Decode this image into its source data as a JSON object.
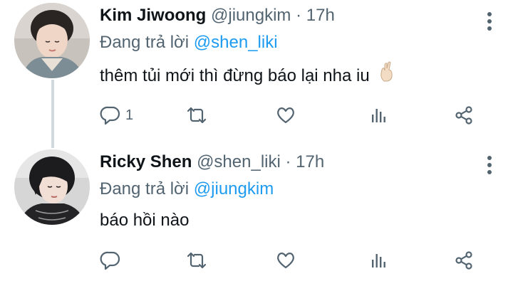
{
  "tweets": [
    {
      "name": "Kim Jiwoong",
      "handle": "@jiungkim",
      "separator": "·",
      "time": "17h",
      "reply_prefix": "Đang trả lời",
      "reply_to": "@shen_liki",
      "text": "thêm tủi mới thì đừng báo lại nha iu",
      "emoji_icon": "crossed-fingers-emoji",
      "reply_count": "1",
      "has_thread_line": true
    },
    {
      "name": "Ricky Shen",
      "handle": "@shen_liki",
      "separator": "·",
      "time": "17h",
      "reply_prefix": "Đang trả lời",
      "reply_to": "@jiungkim",
      "text": "báo hồi nào",
      "reply_count": "",
      "has_thread_line": false
    }
  ],
  "icons": {
    "actions": [
      "reply-icon",
      "retweet-icon",
      "like-icon",
      "stats-icon",
      "share-icon"
    ],
    "more": "more-vertical-icon"
  },
  "colors": {
    "primary_text": "#0f1419",
    "secondary_text": "#536471",
    "mention": "#1d9bf0",
    "thread_line": "#cfd9de"
  }
}
